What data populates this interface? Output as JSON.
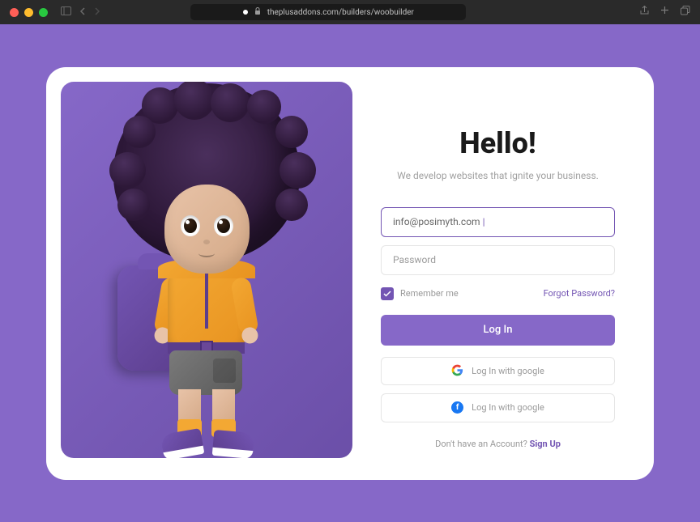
{
  "browser": {
    "url": "theplusaddons.com/builders/woobuilder"
  },
  "login": {
    "title": "Hello!",
    "subtitle": "We develop websites that ignite your business.",
    "email_value": "info@posimyth.com",
    "password_placeholder": "Password",
    "remember_label": "Remember me",
    "forgot_label": "Forgot Password?",
    "login_button": "Log In",
    "google_button": "Log In with google",
    "facebook_button": "Log In with google",
    "signup_prompt": "Don't have an Account? ",
    "signup_link": "Sign Up"
  }
}
